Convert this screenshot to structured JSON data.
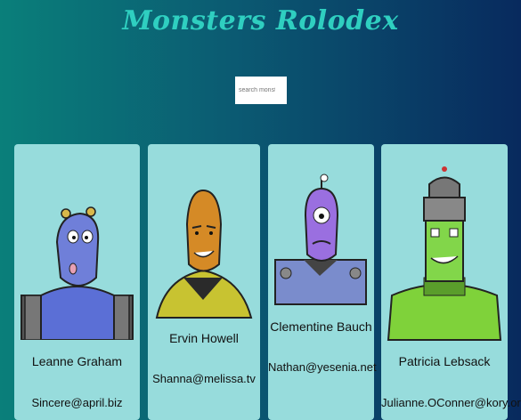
{
  "app": {
    "title": "Monsters Rolodex"
  },
  "search": {
    "placeholder": "search monsters",
    "value": ""
  },
  "monsters": [
    {
      "name": "Leanne Graham",
      "email": "Sincere@april.biz",
      "color": "#6f7fd9"
    },
    {
      "name": "Ervin Howell",
      "email": "Shanna@melissa.tv",
      "color": "#d58a26"
    },
    {
      "name": "Clementine Bauch",
      "email": "Nathan@yesenia.net",
      "color": "#9a6fe0"
    },
    {
      "name": "Patricia Lebsack",
      "email": "Julianne.OConner@kory.org",
      "color": "#7fd23a"
    }
  ]
}
